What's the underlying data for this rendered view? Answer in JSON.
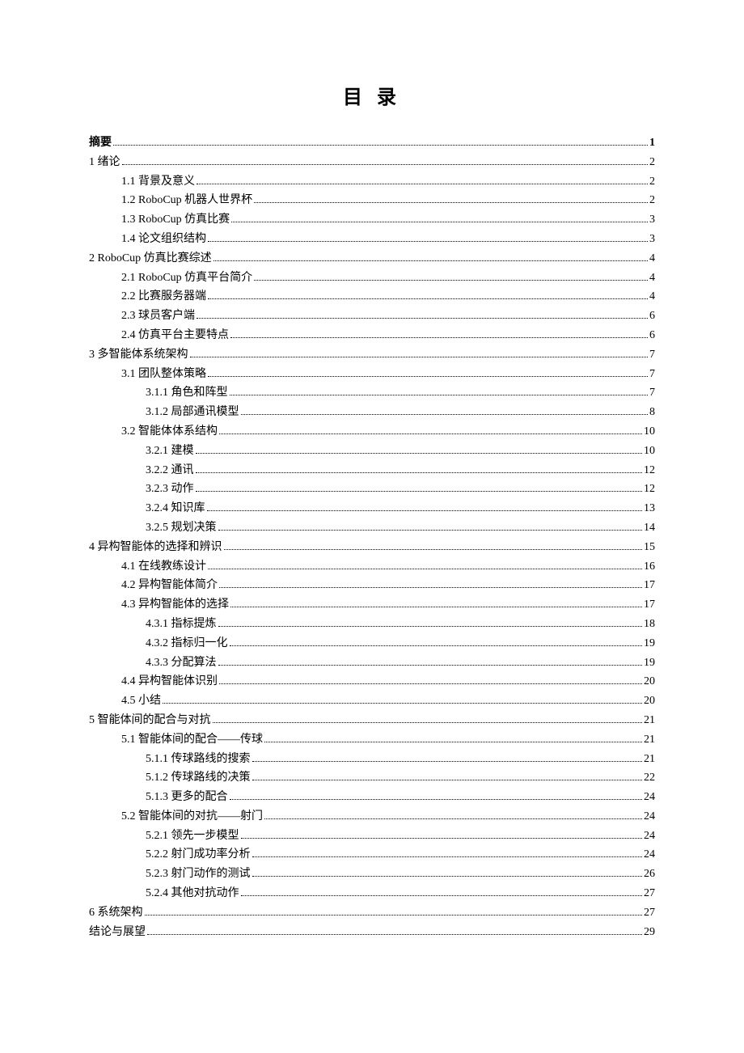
{
  "title": "目 录",
  "entries": [
    {
      "level": 0,
      "label": "摘要",
      "page": "1",
      "bold": true
    },
    {
      "level": 0,
      "label": "1 绪论",
      "page": "2"
    },
    {
      "level": 1,
      "label": "1.1 背景及意义",
      "page": "2"
    },
    {
      "level": 1,
      "label": "1.2 RoboCup 机器人世界杯",
      "page": "2"
    },
    {
      "level": 1,
      "label": "1.3 RoboCup 仿真比赛",
      "page": "3"
    },
    {
      "level": 1,
      "label": "1.4 论文组织结构",
      "page": "3"
    },
    {
      "level": 0,
      "label": "2 RoboCup 仿真比赛综述",
      "page": "4"
    },
    {
      "level": 1,
      "label": "2.1 RoboCup 仿真平台简介",
      "page": "4"
    },
    {
      "level": 1,
      "label": "2.2 比赛服务器端",
      "page": "4"
    },
    {
      "level": 1,
      "label": "2.3 球员客户端",
      "page": "6"
    },
    {
      "level": 1,
      "label": "2.4 仿真平台主要特点",
      "page": "6"
    },
    {
      "level": 0,
      "label": "3 多智能体系统架构",
      "page": "7"
    },
    {
      "level": 1,
      "label": "3.1 团队整体策略",
      "page": "7"
    },
    {
      "level": 2,
      "label": "3.1.1 角色和阵型",
      "page": "7"
    },
    {
      "level": 2,
      "label": "3.1.2 局部通讯模型",
      "page": "8"
    },
    {
      "level": 1,
      "label": "3.2 智能体体系结构",
      "page": "10"
    },
    {
      "level": 2,
      "label": "3.2.1 建模",
      "page": "10"
    },
    {
      "level": 2,
      "label": "3.2.2 通讯",
      "page": "12"
    },
    {
      "level": 2,
      "label": "3.2.3 动作",
      "page": "12"
    },
    {
      "level": 2,
      "label": "3.2.4 知识库",
      "page": "13"
    },
    {
      "level": 2,
      "label": "3.2.5 规划决策",
      "page": "14"
    },
    {
      "level": 0,
      "label": "4 异构智能体的选择和辨识",
      "page": "15"
    },
    {
      "level": 1,
      "label": "4.1 在线教练设计",
      "page": "16"
    },
    {
      "level": 1,
      "label": "4.2 异构智能体简介",
      "page": "17"
    },
    {
      "level": 1,
      "label": "4.3 异构智能体的选择",
      "page": "17"
    },
    {
      "level": 2,
      "label": "4.3.1 指标提炼",
      "page": "18"
    },
    {
      "level": 2,
      "label": "4.3.2 指标归一化",
      "page": "19"
    },
    {
      "level": 2,
      "label": "4.3.3 分配算法",
      "page": "19"
    },
    {
      "level": 1,
      "label": "4.4 异构智能体识别",
      "page": "20"
    },
    {
      "level": 1,
      "label": "4.5 小结",
      "page": "20"
    },
    {
      "level": 0,
      "label": "5 智能体间的配合与对抗",
      "page": "21"
    },
    {
      "level": 1,
      "label": "5.1 智能体间的配合——传球",
      "page": "21"
    },
    {
      "level": 2,
      "label": "5.1.1 传球路线的搜索",
      "page": "21"
    },
    {
      "level": 2,
      "label": "5.1.2 传球路线的决策",
      "page": "22"
    },
    {
      "level": 2,
      "label": "5.1.3 更多的配合",
      "page": "24"
    },
    {
      "level": 1,
      "label": "5.2 智能体间的对抗——射门",
      "page": "24"
    },
    {
      "level": 2,
      "label": "5.2.1 领先一步模型",
      "page": "24"
    },
    {
      "level": 2,
      "label": "5.2.2 射门成功率分析",
      "page": "24"
    },
    {
      "level": 2,
      "label": "5.2.3 射门动作的测试",
      "page": "26"
    },
    {
      "level": 2,
      "label": "5.2.4 其他对抗动作",
      "page": "27"
    },
    {
      "level": 0,
      "label": "6 系统架构",
      "page": "27"
    },
    {
      "level": 0,
      "label": "结论与展望",
      "page": "29"
    }
  ]
}
